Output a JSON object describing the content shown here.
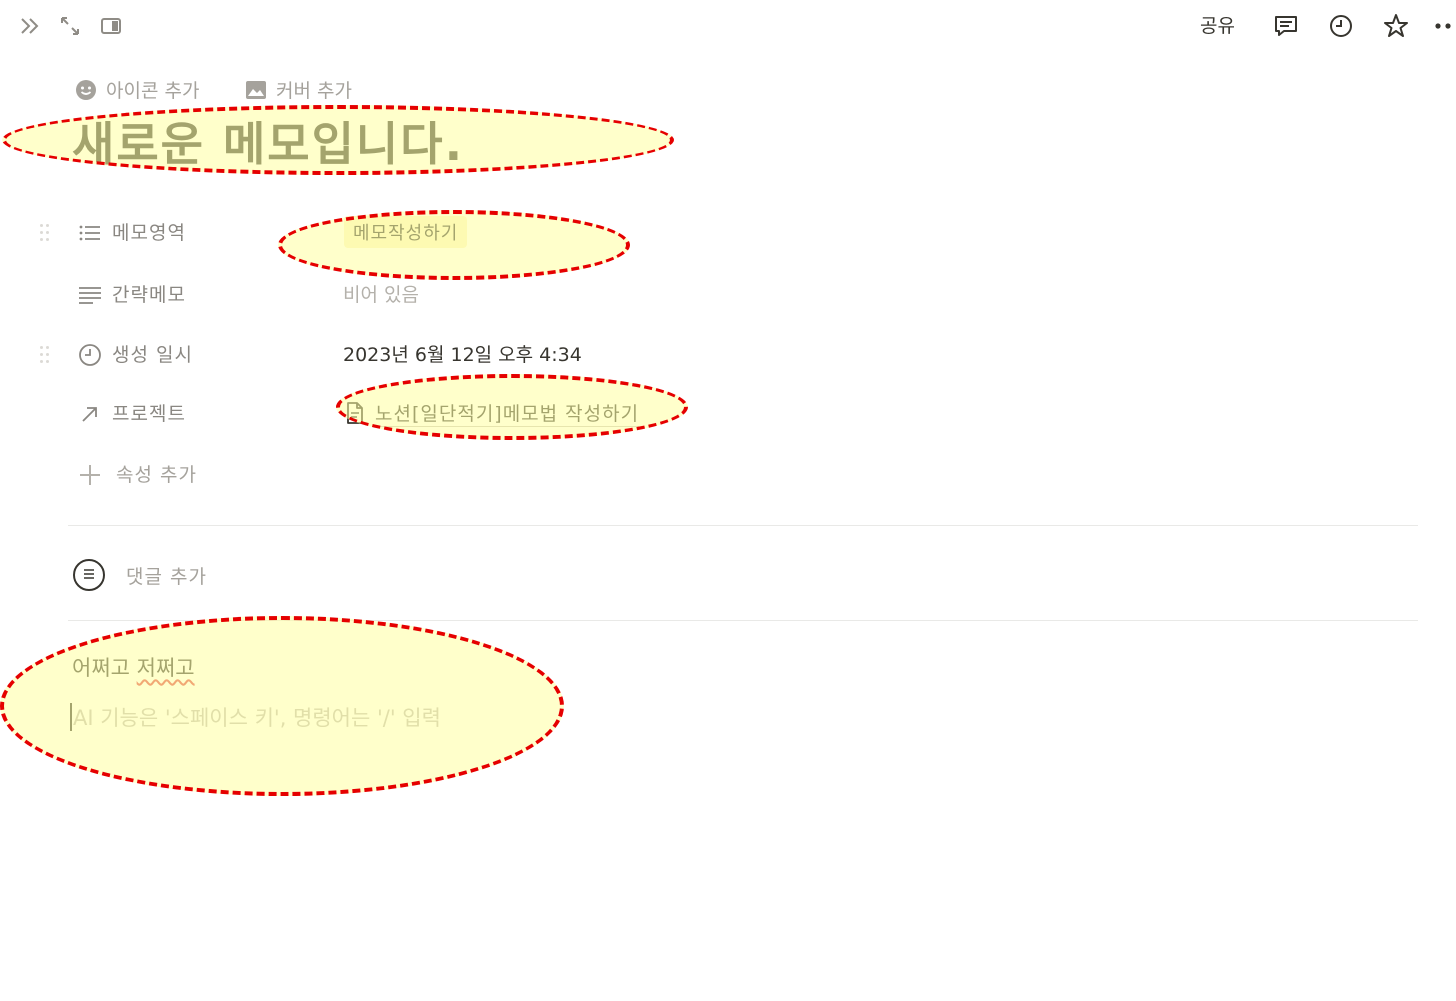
{
  "topbar": {
    "share_label": "공유",
    "icons": [
      "double-chevron-right-icon",
      "expand-icon",
      "side-panel-icon",
      "comment-icon",
      "clock-icon",
      "star-icon",
      "more-icon"
    ]
  },
  "page": {
    "add_icon_label": "아이콘 추가",
    "add_cover_label": "커버 추가",
    "title": "새로운 메모입니다."
  },
  "properties": [
    {
      "label": "메모영역",
      "value": "메모작성하기",
      "icon": "list-icon"
    },
    {
      "label": "간략메모",
      "value": "비어 있음",
      "icon": "text-lines-icon"
    },
    {
      "label": "생성 일시",
      "value": "2023년 6월 12일 오후 4:34",
      "icon": "clock-icon"
    },
    {
      "label": "프로젝트",
      "value": "노션[일단적기]메모법 작성하기",
      "icon": "arrow-up-right-icon"
    }
  ],
  "add_property_label": "속성 추가",
  "comment": {
    "placeholder": "댓글 추가"
  },
  "content": {
    "line1_a": "어쩌고 ",
    "line1_b": "저쩌고",
    "placeholder": "AI 기능은 '스페이스 키', 명령어는 '/' 입력"
  },
  "annotation": {
    "color": "#e50000",
    "fill": "#ffffa0"
  }
}
